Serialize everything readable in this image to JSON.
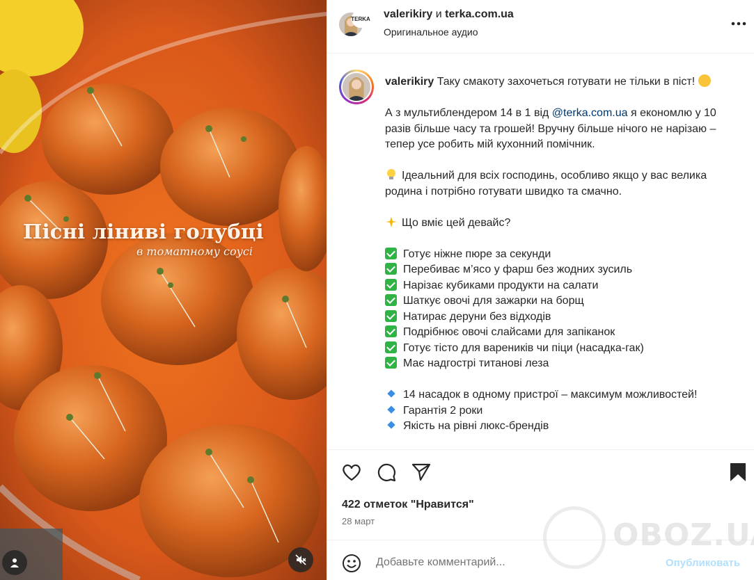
{
  "post": {
    "overlay_title": "Пісні ліниві голубці",
    "overlay_subtitle": "в томатному соусі"
  },
  "header": {
    "author": "valerikiry",
    "conjunction": " и ",
    "coauthor": "terka.com.ua",
    "coauthor_badge": "TERKA",
    "audio": "Оригинальное аудио"
  },
  "caption": {
    "username": "valerikiry",
    "intro": " Таку смакоту захочеться готувати не тільки в піст! ",
    "para1_before": "А з мультиблендером 14 в 1 від ",
    "mention": "@terka.com.ua",
    "para1_after": " я економлю у 10 разів більше часу та грошей! Вручну більше нічого не нарізаю – тепер усе робить мій кухонний помічник.",
    "para2": "Ідеальний для всіх господинь, особливо якщо у вас велика родина і потрібно готувати швидко та смачно.",
    "para3": "Що вміє цей девайс?",
    "checks": [
      "Готує ніжне пюре за секунди",
      "Перебиває м’ясо у фарш без жодних зусиль",
      "Нарізає кубиками продукти на салати",
      "Шаткує овочі для зажарки на борщ",
      "Натирає деруни без відходів",
      "Подрібнює овочі слайсами для запіканок",
      "Готує тісто для вареників чи піци (насадка-гак)",
      "Має надгострі титанові леза"
    ],
    "bullets": [
      "14 насадок в одному пристрої – максимум можливостей!",
      "Гарантія 2 роки",
      "Якість на рівні люкс-брендів"
    ]
  },
  "stats": {
    "likes": "422 отметок \"Нравится\"",
    "date": "28 март"
  },
  "comment": {
    "placeholder": "Добавьте комментарий...",
    "publish_label": "Опубликовать"
  },
  "watermark": "OBOZ.UA",
  "colors": {
    "accent_link": "#00376b",
    "publish_disabled": "#b2dffc",
    "check_green": "#2fb344",
    "diamond_blue": "#3a8ee6"
  }
}
